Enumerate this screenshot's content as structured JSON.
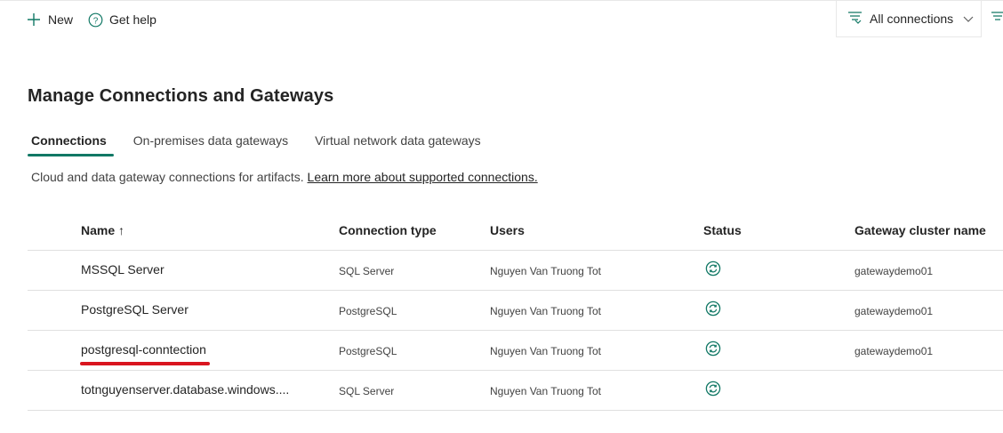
{
  "toolbar": {
    "new_label": "New",
    "help_label": "Get help",
    "filter_label": "All connections"
  },
  "page": {
    "title": "Manage Connections and Gateways"
  },
  "tabs": [
    {
      "label": "Connections",
      "active": true
    },
    {
      "label": "On-premises data gateways",
      "active": false
    },
    {
      "label": "Virtual network data gateways",
      "active": false
    }
  ],
  "description": {
    "text": "Cloud and data gateway connections for artifacts.",
    "link": "Learn more about supported connections."
  },
  "table": {
    "columns": [
      "Name ↑",
      "Connection type",
      "Users",
      "Status",
      "Gateway cluster name"
    ],
    "rows": [
      {
        "name": "MSSQL Server",
        "type": "SQL Server",
        "users": "Nguyen Van Truong Tot",
        "status": "refresh-status-icon",
        "gateway": "gatewaydemo01"
      },
      {
        "name": "PostgreSQL Server",
        "type": "PostgreSQL",
        "users": "Nguyen Van Truong Tot",
        "status": "refresh-status-icon",
        "gateway": "gatewaydemo01"
      },
      {
        "name": "postgresql-conntection",
        "type": "PostgreSQL",
        "users": "Nguyen Van Truong Tot",
        "status": "refresh-status-icon",
        "gateway": "gatewaydemo01"
      },
      {
        "name": "totnguyenserver.database.windows....",
        "type": "SQL Server",
        "users": "Nguyen Van Truong Tot",
        "status": "refresh-status-icon",
        "gateway": ""
      }
    ]
  },
  "colors": {
    "accent": "#117865",
    "highlight_underline": "#d9151f"
  }
}
